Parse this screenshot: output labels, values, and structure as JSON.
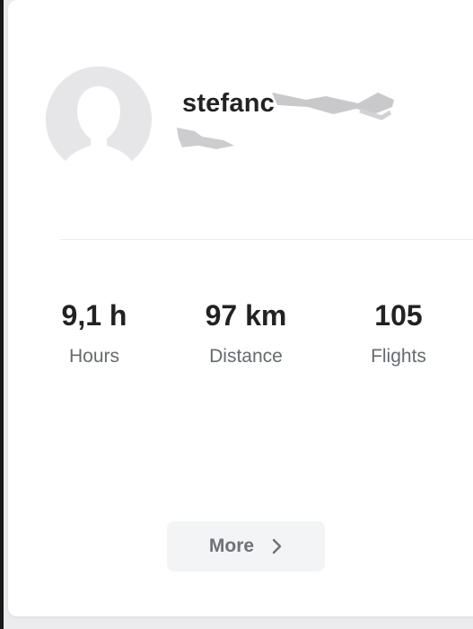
{
  "profile": {
    "username": "stefanc",
    "avatar_icon": "default-user-avatar-icon"
  },
  "stats": [
    {
      "value": "9,1 h",
      "label": "Hours"
    },
    {
      "value": "97 km",
      "label": "Distance"
    },
    {
      "value": "105",
      "label": "Flights"
    }
  ],
  "more_button": {
    "label": "More",
    "icon": "chevron-right-icon"
  },
  "colors": {
    "card_background": "#ffffff",
    "page_background": "#ececee",
    "avatar_background": "#e6e6e8",
    "text_primary": "#222222",
    "text_secondary": "#666a70",
    "button_background": "#f3f4f6"
  }
}
